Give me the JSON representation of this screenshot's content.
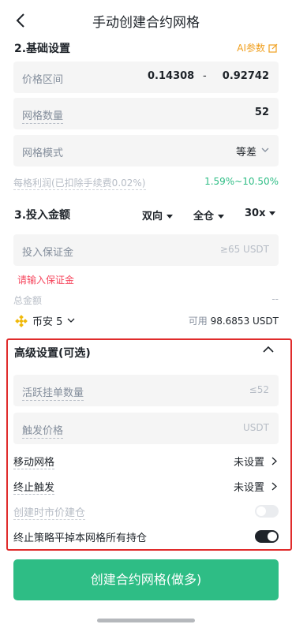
{
  "header": {
    "title": "手动创建合约网格"
  },
  "basic": {
    "title": "2.基础设置",
    "ai_label": "AI参数",
    "price_range": {
      "label": "价格区间",
      "low": "0.14308",
      "sep": "-",
      "high": "0.92742"
    },
    "grid_count": {
      "label": "网格数量",
      "value": "52"
    },
    "grid_mode": {
      "label": "网格模式",
      "value": "等差"
    },
    "profit": {
      "label": "每格利润(已扣除手续费0.02%)",
      "value": "1.59%~10.50%"
    }
  },
  "invest": {
    "title": "3.投入金额",
    "direction": "双向",
    "margin_mode": "全仓",
    "leverage": "30x",
    "margin_field": {
      "label": "投入保证金",
      "placeholder": "≥65  USDT"
    },
    "error": "请输入保证金",
    "total_label": "总金额",
    "total_value": "--",
    "exchange": "币安 5",
    "available_label": "可用",
    "available_value": "98.6853 USDT"
  },
  "advanced": {
    "title": "高级设置(可选)",
    "active_orders": {
      "label": "活跃挂单数量",
      "placeholder": "≤52"
    },
    "trigger_price": {
      "label": "触发价格",
      "placeholder": "USDT"
    },
    "moving_grid": {
      "label": "移动网格",
      "value": "未设置"
    },
    "stop_trigger": {
      "label": "终止触发",
      "value": "未设置"
    },
    "market_open": {
      "label": "创建时市价建仓",
      "on": false
    },
    "close_all": {
      "label": "终止策略平掉本网格所有持仓",
      "on": true
    }
  },
  "create_button": "创建合约网格(做多)",
  "colors": {
    "accent": "#2ebd85",
    "warning": "#f0a020",
    "error": "#f6465d",
    "highlight_box": "#e02b2b"
  }
}
